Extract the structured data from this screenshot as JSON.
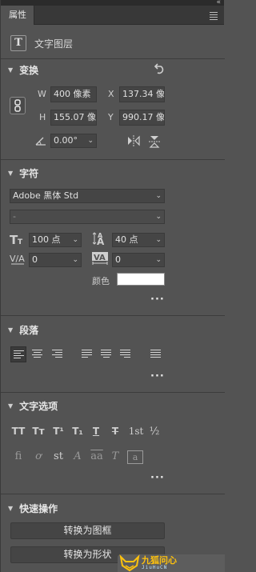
{
  "panel": {
    "tab_label": "属性",
    "collapse_glyph": "«"
  },
  "layer": {
    "type_glyph": "T",
    "label": "文字图层"
  },
  "transform": {
    "title": "变换",
    "w_label": "W",
    "w_value": "400 像素",
    "x_label": "X",
    "x_value": "137.34 像",
    "h_label": "H",
    "h_value": "155.07 像",
    "y_label": "Y",
    "y_value": "990.17 像",
    "angle_value": "0.00°"
  },
  "character": {
    "title": "字符",
    "font_family": "Adobe 黑体 Std",
    "font_style": "-",
    "font_size": "100 点",
    "leading": "40 点",
    "kerning": "0",
    "tracking": "0",
    "color_label": "颜色",
    "color_value": "#ffffff"
  },
  "paragraph": {
    "title": "段落"
  },
  "type_options": {
    "title": "文字选项",
    "glyphs_row1": [
      "TT",
      "Tт",
      "T¹",
      "T₁",
      "T",
      "T",
      "1st",
      "½"
    ],
    "glyphs_row2": [
      "fi",
      "ơ",
      "st",
      "A",
      "aa",
      "T",
      "a"
    ]
  },
  "quick_actions": {
    "title": "快速操作",
    "convert_frame": "转换为图框",
    "convert_shape": "转换为形状"
  },
  "watermark": {
    "brand": "九狐问心",
    "sub": "JiuHuCN"
  },
  "colors": {
    "panel_bg": "#535353",
    "field_bg": "#454545",
    "watermark_accent": "#ffc20e"
  }
}
